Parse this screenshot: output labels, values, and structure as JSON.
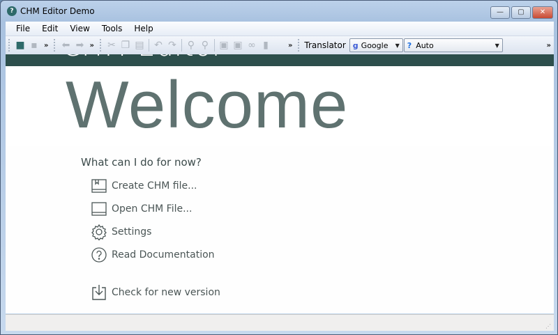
{
  "window": {
    "title": "CHM Editor Demo",
    "buttons": {
      "minimize": "—",
      "maximize": "▢",
      "close": "✕"
    }
  },
  "menu": [
    "File",
    "Edit",
    "View",
    "Tools",
    "Help"
  ],
  "toolbar": {
    "translator_label": "Translator",
    "engine": "Google",
    "language": "Auto",
    "overflow": "»"
  },
  "banner": {
    "app_name": "CHM Editor"
  },
  "welcome": {
    "heading": "Welcome",
    "question": "What can I do for now?",
    "actions": [
      {
        "label": "Create CHM file...",
        "icon": "book-bookmark-icon"
      },
      {
        "label": "Open CHM File...",
        "icon": "book-icon"
      },
      {
        "label": "Settings",
        "icon": "gear-icon"
      },
      {
        "label": "Read Documentation",
        "icon": "question-icon"
      },
      {
        "label": "Check for new version",
        "icon": "download-icon"
      }
    ]
  },
  "colors": {
    "banner": "#2d4f4c",
    "heading": "#5f7270"
  }
}
